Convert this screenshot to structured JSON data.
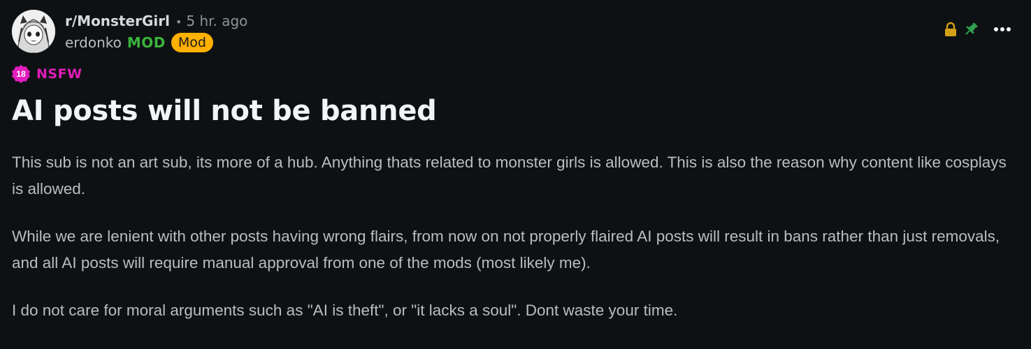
{
  "post": {
    "subreddit": "r/MonsterGirl",
    "separator": "•",
    "time": "5 hr. ago",
    "author": "erdonko",
    "mod_tag": "MOD",
    "flair": "Mod",
    "nsfw_badge": "18",
    "nsfw_label": "NSFW",
    "title": "AI posts will not be banned",
    "paragraphs": [
      "This sub is not an art sub, its more of a hub. Anything thats related to monster girls is allowed. This is also the reason why content like cosplays is allowed.",
      "While we are lenient with other posts having wrong flairs, from now on not properly flaired AI posts will result in bans rather than just removals, and all AI posts will require manual approval from one of the mods (most likely me).",
      "I do not care for moral arguments such as \"AI is theft\", or \"it lacks a soul\". Dont waste your time."
    ]
  },
  "actions": {
    "icons": [
      "lock-icon",
      "pin-icon",
      "more-options-icon"
    ]
  },
  "colors": {
    "background": "#0e1113",
    "mod_green": "#3bb33b",
    "flair_orange": "#ffb000",
    "nsfw_pink": "#e11dbb",
    "lock_gold": "#d4a017",
    "pin_green": "#2ea44f"
  }
}
